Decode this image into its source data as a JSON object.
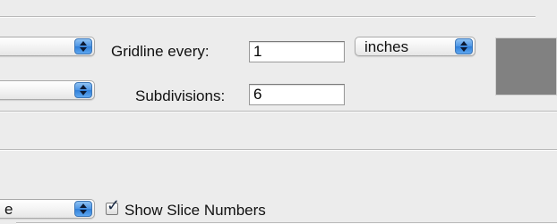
{
  "grid": {
    "style_popup_value": "",
    "gridline_label": "Gridline every:",
    "gridline_value": "1",
    "unit_value": "inches",
    "subdivisions_label": "Subdivisions:",
    "subdivisions_value": "6",
    "color_swatch": "#818181"
  },
  "slices": {
    "popup_value": "e",
    "show_numbers_label": "Show Slice Numbers",
    "show_numbers_checked": true,
    "checkmark": "✓"
  },
  "colors": {
    "background": "#ececec",
    "popup_arrow_blue": "#4c95e6",
    "field_border": "#9a9a9a"
  }
}
